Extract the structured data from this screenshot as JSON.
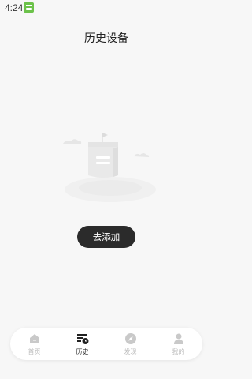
{
  "status_bar": {
    "time": "4:24"
  },
  "page": {
    "title": "历史设备"
  },
  "empty_state": {
    "action_label": "去添加"
  },
  "tab_bar": {
    "tabs": [
      {
        "label": "首页",
        "icon": "home-icon",
        "active": false
      },
      {
        "label": "历史",
        "icon": "history-icon",
        "active": true
      },
      {
        "label": "发现",
        "icon": "compass-icon",
        "active": false
      },
      {
        "label": "我的",
        "icon": "user-icon",
        "active": false
      }
    ]
  },
  "colors": {
    "background": "#f7f7f7",
    "button": "#2b2b2b",
    "active_tab": "#333333",
    "inactive_tab": "#bdbdbd"
  }
}
